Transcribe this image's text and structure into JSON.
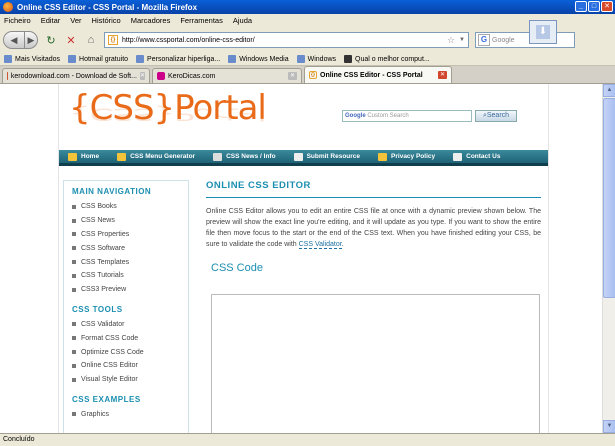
{
  "window": {
    "title": "Online CSS Editor - CSS Portal - Mozilla Firefox"
  },
  "menu": [
    "Ficheiro",
    "Editar",
    "Ver",
    "Histórico",
    "Marcadores",
    "Ferramentas",
    "Ajuda"
  ],
  "address": {
    "url": "http://www.cssportal.com/online-css-editor/",
    "search_placeholder": "Google"
  },
  "bookmarks": [
    "Mais Visitados",
    "Hotmail gratuito",
    "Personalizar hiperliga...",
    "Windows Media",
    "Windows",
    "Qual o melhor comput..."
  ],
  "tabs": [
    {
      "label": "kerodownload.com - Download de Soft...",
      "active": false
    },
    {
      "label": "KeroDicas.com",
      "active": false
    },
    {
      "label": "Online CSS Editor - CSS Portal",
      "active": true
    }
  ],
  "site": {
    "logo": "{CSS}Portal",
    "search_placeholder": "Custom Search",
    "search_brand": "Google",
    "search_button": "Search",
    "nav": [
      "Home",
      "CSS Menu Generator",
      "CSS News / Info",
      "Submit Resource",
      "Privacy Policy",
      "Contact Us"
    ]
  },
  "sidebar": {
    "main_title": "MAIN NAVIGATION",
    "main_items": [
      "CSS Books",
      "CSS News",
      "CSS Properties",
      "CSS Software",
      "CSS Templates",
      "CSS Tutorials",
      "CSS3 Preview"
    ],
    "tools_title": "CSS TOOLS",
    "tools_items": [
      "CSS Validator",
      "Format CSS Code",
      "Optimize CSS Code",
      "Online CSS Editor",
      "Visual Style Editor"
    ],
    "examples_title": "CSS EXAMPLES",
    "examples_items": [
      "Graphics"
    ]
  },
  "main": {
    "title": "ONLINE CSS EDITOR",
    "description": "Online CSS Editor allows you to edit an entire CSS file at once with a dynamic preview shown below. The preview will show the exact line you're editing, and it will update as you type. If you want to show the entire file then move focus to the start or the end of the CSS text. When you have finished editing your CSS, be sure to validate the code with",
    "validator_link": "CSS Validator",
    "code_title": "CSS Code"
  },
  "status": {
    "text": "Concluído"
  }
}
